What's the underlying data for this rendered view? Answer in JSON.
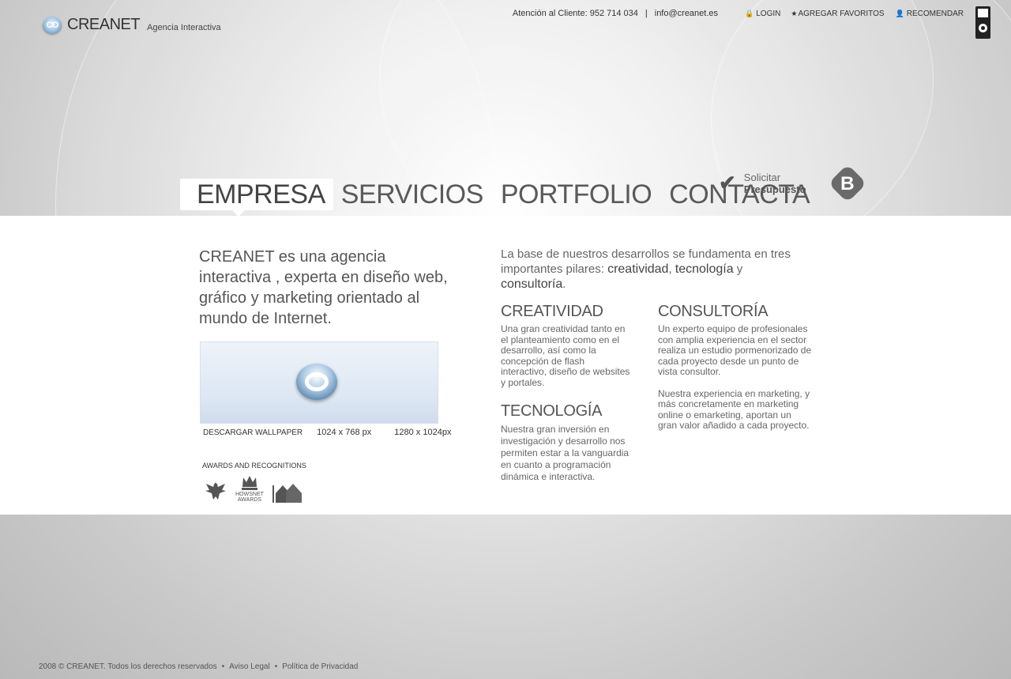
{
  "brand": {
    "mark": "CO",
    "name": "CREANET",
    "tagline": "Agencia Interactiva"
  },
  "topbar": {
    "phone_text": "Atención al Cliente: 952 714 034",
    "separator": "|",
    "email": "info@creanet.es",
    "links": [
      {
        "label": "LOGIN",
        "icon": "lock-icon",
        "glyph": "🔒"
      },
      {
        "label": "AGREGAR FAVORITOS",
        "icon": "star-icon",
        "glyph": "★"
      },
      {
        "label": "RECOMENDAR",
        "icon": "person-icon",
        "glyph": "👤"
      }
    ]
  },
  "nav": {
    "items": [
      {
        "label": "EMPRESA",
        "active": true
      },
      {
        "label": "SERVICIOS",
        "active": false
      },
      {
        "label": "PORTFOLIO",
        "active": false
      },
      {
        "label": "CONTACTA",
        "active": false
      }
    ]
  },
  "quote": {
    "line1": "Solicitar",
    "line2": "Presupuesto",
    "badge_letter": "B"
  },
  "intro": "CREANET es una agencia interactiva , experta en diseño web, gráfico  y marketing orientado al mundo de Internet.",
  "wallpaper": {
    "label": "DESCARGAR WALLPAPER",
    "res1": "1024 x 768 px",
    "res2": "1280 x 1024px"
  },
  "awards": {
    "label": "AWARDS AND RECOGNITIONS",
    "hownet_text1": "HOWSNET",
    "hownet_text2": "AWARDS"
  },
  "pillars": {
    "lead": "La base de nuestros desarrollos se fundamenta en tres importantes pilares: ",
    "w1": "creatividad",
    "c1": ", ",
    "w2": "tecnología",
    "c2": " y ",
    "w3": "consultoría",
    "end": "."
  },
  "sections": {
    "creatividad": {
      "title": "CREATIVIDAD",
      "text": "Una gran creatividad tanto en el planteamiento como en el desarrollo, así como la concepción de flash interactivo, diseño de websites y portales."
    },
    "tecnologia": {
      "title": "TECNOLOGÍA",
      "text": "Nuestra gran inversión en investigación y desarrollo nos permiten estar a la vanguardia en cuanto a programación dinámica e interactiva."
    },
    "consultoria": {
      "title": "CONSULTORÍA",
      "text1": "Un experto equipo de profesionales con  amplia experiencia en el sector realiza un estudio pormenorizado de cada  proyecto desde un punto de vista consultor.",
      "text2": "Nuestra experiencia en marketing, y más concretamente en marketing online o emarketing, aportan un gran valor añadido a cada proyecto."
    }
  },
  "footer": {
    "copyright": "2008 © CREANET. Todos los derechos reservados",
    "dot": "•",
    "legal": "Aviso Legal",
    "privacy": "Política de Privacidad"
  }
}
